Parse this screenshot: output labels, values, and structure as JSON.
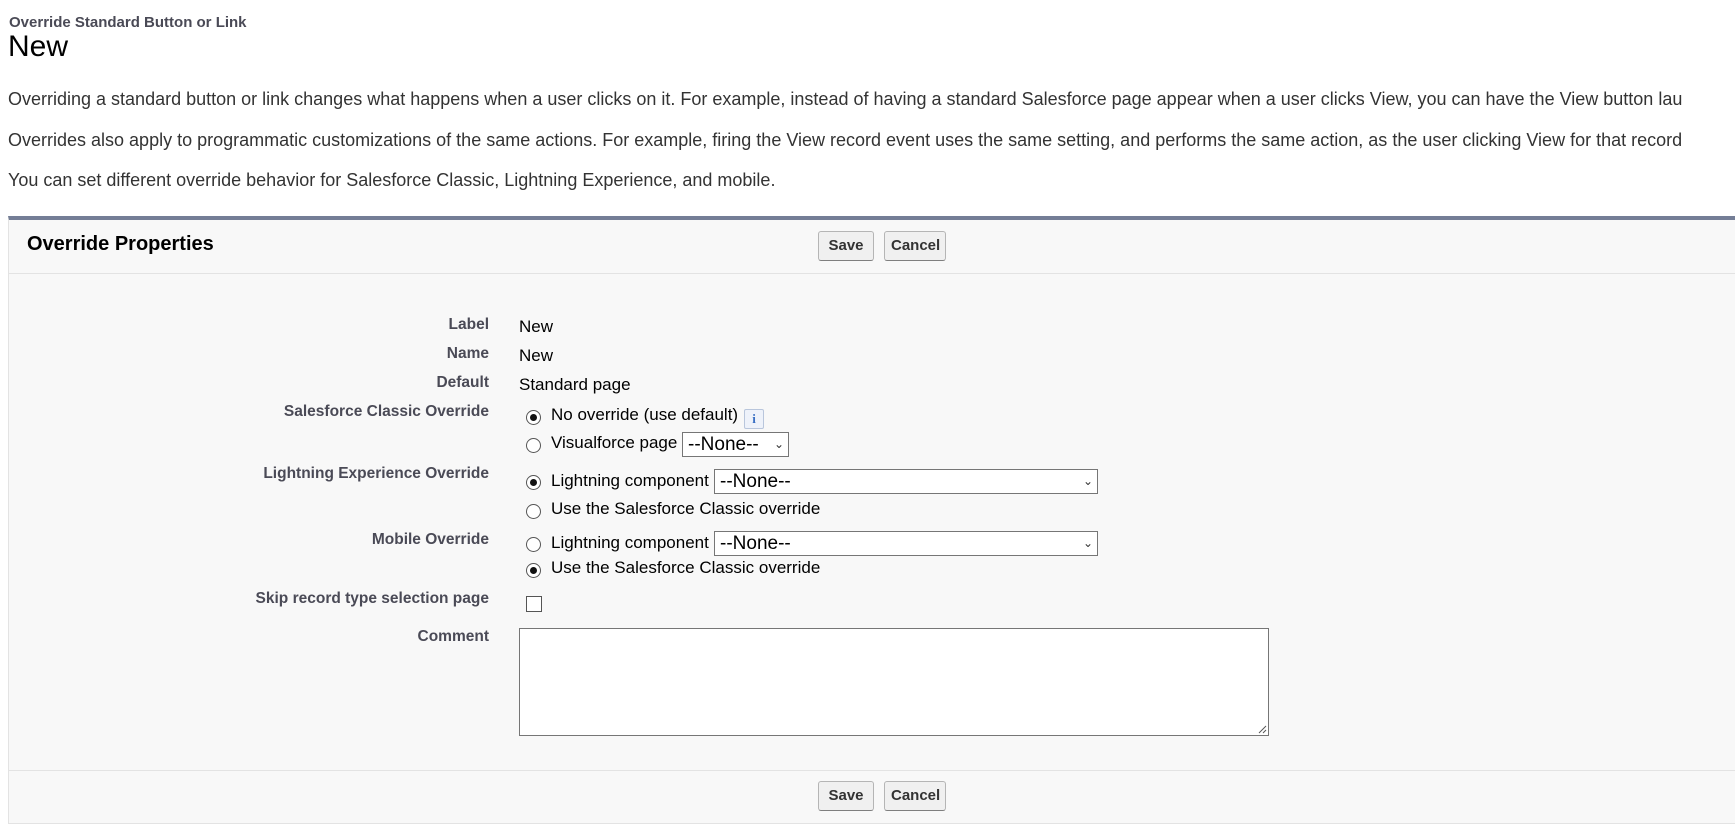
{
  "header": {
    "breadcrumb": "Override Standard Button or Link",
    "title": "New"
  },
  "intro": [
    "Overriding a standard button or link changes what happens when a user clicks on it. For example, instead of having a standard Salesforce page appear when a user clicks View, you can have the View button lau",
    "Overrides also apply to programmatic customizations of the same actions. For example, firing the View record event uses the same setting, and performs the same action, as the user clicking View for that record",
    "You can set different override behavior for Salesforce Classic, Lightning Experience, and mobile."
  ],
  "panel": {
    "title": "Override Properties",
    "save_label": "Save",
    "cancel_label": "Cancel"
  },
  "fields": {
    "label": {
      "label": "Label",
      "value": "New"
    },
    "name": {
      "label": "Name",
      "value": "New"
    },
    "default": {
      "label": "Default",
      "value": "Standard page"
    },
    "classic": {
      "label": "Salesforce Classic Override",
      "option1": "No override (use default)",
      "option2": "Visualforce page",
      "select_value": "--None--",
      "selected": "option1"
    },
    "lightning": {
      "label": "Lightning Experience Override",
      "option1": "Lightning component",
      "option2": "Use the Salesforce Classic override",
      "select_value": "--None--",
      "selected": "option1"
    },
    "mobile": {
      "label": "Mobile Override",
      "option1": "Lightning component",
      "option2": "Use the Salesforce Classic override",
      "select_value": "--None--",
      "selected": "option2"
    },
    "skip": {
      "label": "Skip record type selection page",
      "checked": false
    },
    "comment": {
      "label": "Comment",
      "value": ""
    }
  },
  "icons": {
    "info": "i"
  }
}
